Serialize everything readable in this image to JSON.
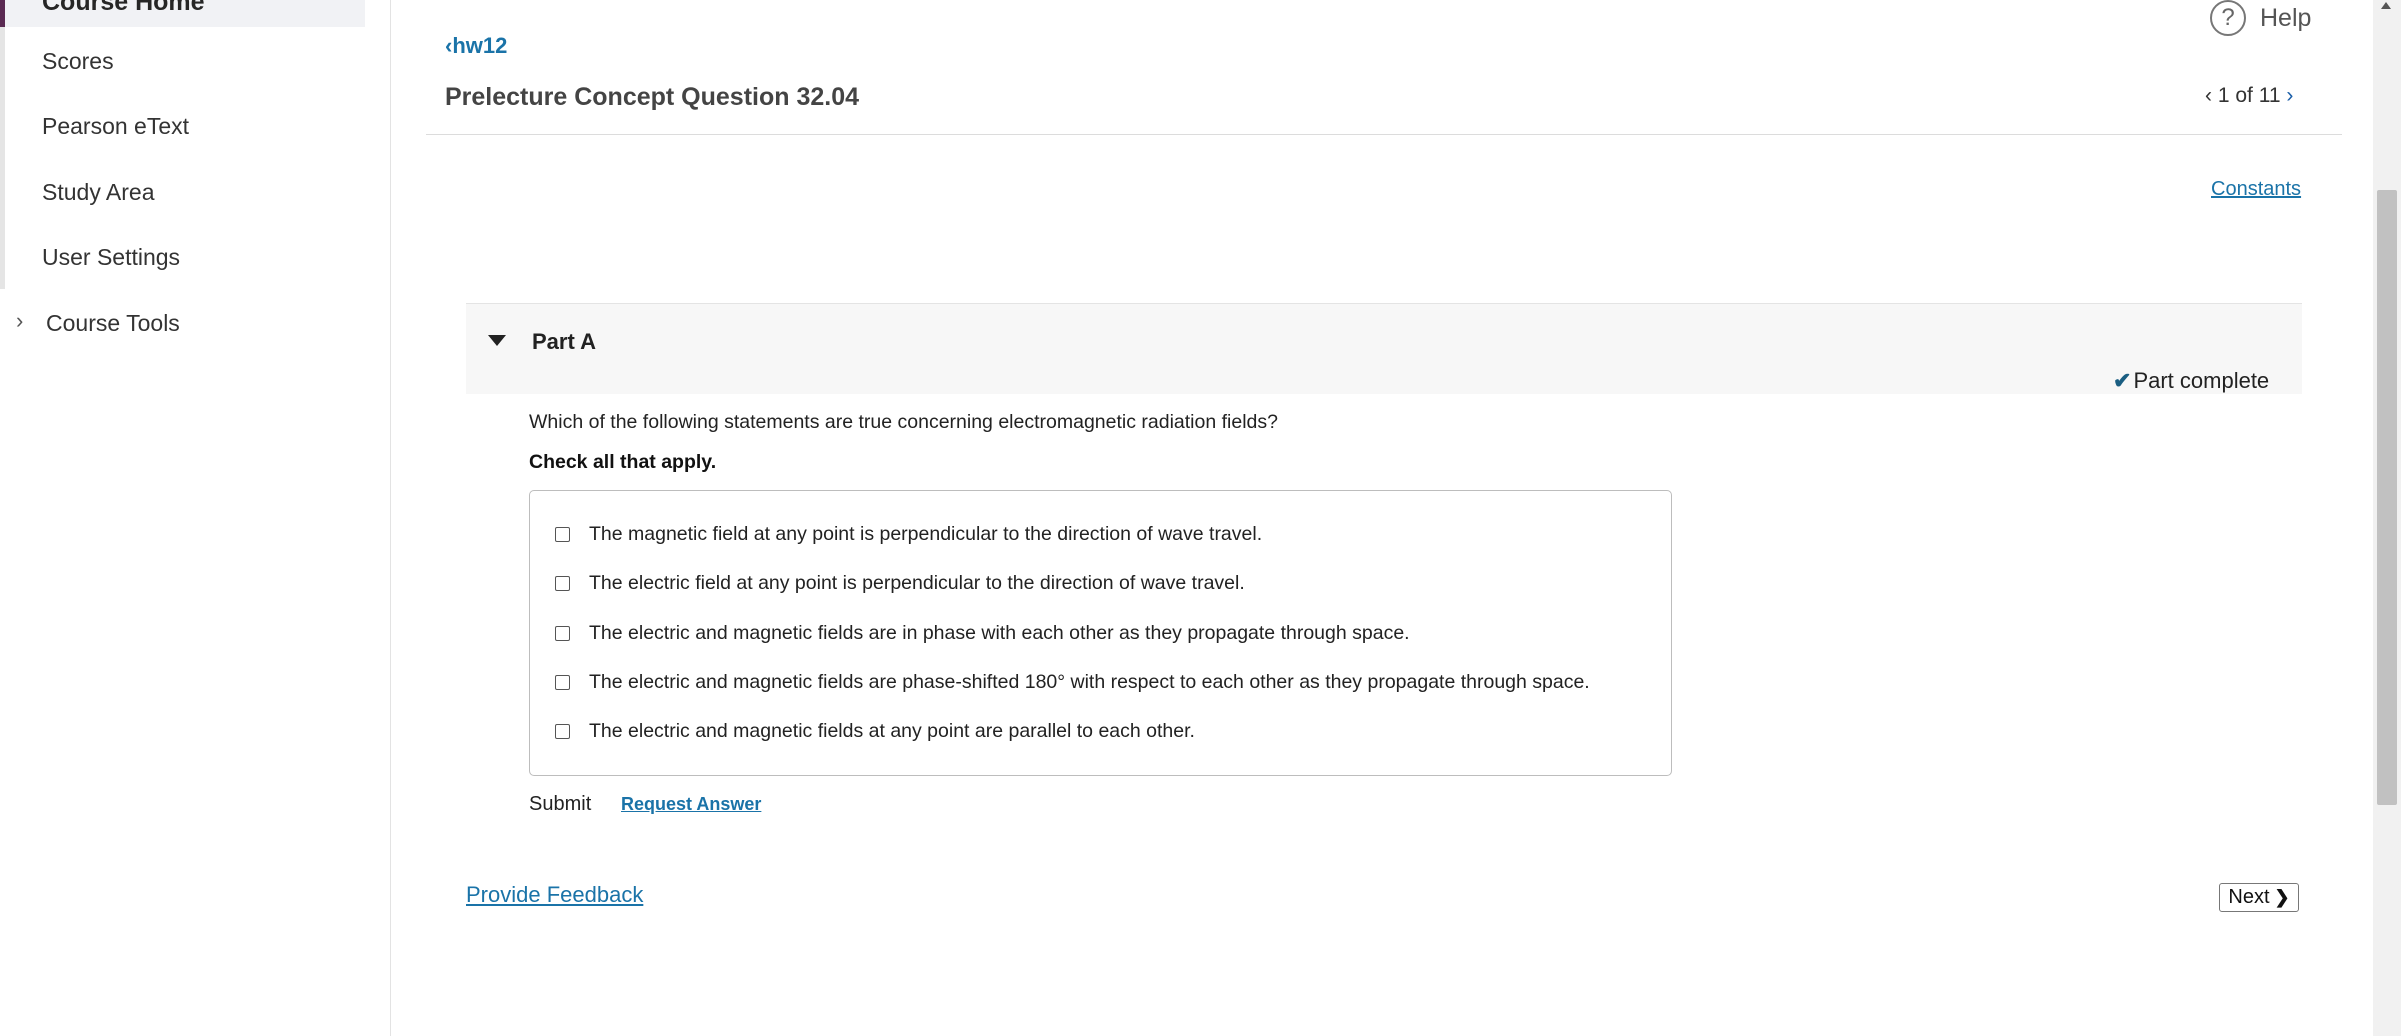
{
  "sidebar": {
    "active_item": "Course Home",
    "items": [
      {
        "label": "Scores"
      },
      {
        "label": "Pearson eText"
      },
      {
        "label": "Study Area"
      },
      {
        "label": "User Settings"
      },
      {
        "label": "Course Tools"
      }
    ]
  },
  "header": {
    "back_link": "hw12",
    "title": "Prelecture Concept Question 32.04",
    "help": "Help",
    "pager": {
      "text": "1 of 11",
      "prev": "‹",
      "next": "›"
    },
    "constants_link": "Constants"
  },
  "part": {
    "title": "Part A",
    "status": "Part complete",
    "question": "Which of the following statements are true concerning electromagnetic radiation fields?",
    "instruction": "Check all that apply.",
    "options": [
      {
        "label": "The magnetic field at any point is perpendicular to the direction of wave travel.",
        "checked": false
      },
      {
        "label": "The electric field at any point is perpendicular to the direction of wave travel.",
        "checked": false
      },
      {
        "label": "The electric and magnetic fields are in phase with each other as they propagate through space.",
        "checked": false
      },
      {
        "label": "The electric and magnetic fields are phase-shifted 180° with respect to each other as they propagate through space.",
        "checked": false
      },
      {
        "label": "The electric and magnetic fields at any point are parallel to each other.",
        "checked": false
      }
    ],
    "submit": "Submit",
    "request_answer": "Request Answer"
  },
  "footer": {
    "feedback": "Provide Feedback",
    "next": "Next"
  },
  "colors": {
    "link": "#1a73a8",
    "accent": "#5a2a52",
    "check": "#1a5e82"
  },
  "icons": [
    "chevron-left-icon",
    "help-circle-icon",
    "chevron-right-icon",
    "caret-down-icon",
    "checkmark-icon"
  ]
}
